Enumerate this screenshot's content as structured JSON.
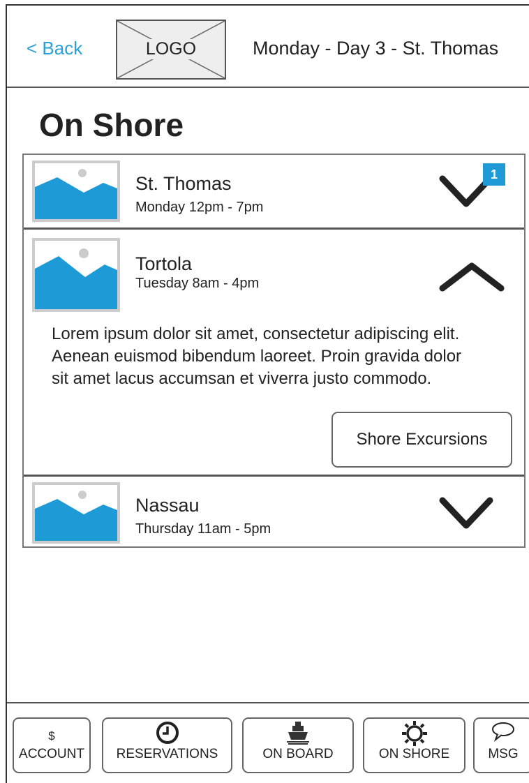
{
  "header": {
    "back_label": "< Back",
    "logo_label": "LOGO",
    "title": "Monday - Day 3 - St. Thomas"
  },
  "page": {
    "title": "On Shore"
  },
  "ports": [
    {
      "name": "St. Thomas",
      "time": "Monday 12pm - 7pm",
      "expanded": false,
      "badge": "1"
    },
    {
      "name": "Tortola",
      "time": "Tuesday 8am - 4pm",
      "expanded": true,
      "description": "Lorem ipsum dolor sit amet, consectetur adipiscing elit. Aenean euismod bibendum laoreet. Proin gravida dolor sit amet lacus accumsan et viverra justo commodo.",
      "button_label": "Shore Excursions"
    },
    {
      "name": "Nassau",
      "time": "Thursday 11am - 5pm",
      "expanded": false
    }
  ],
  "bottom_nav": {
    "account": {
      "icon_text": "$",
      "label": "ACCOUNT"
    },
    "reservations": {
      "icon": "clock-icon",
      "label": "RESERVATIONS"
    },
    "on_board": {
      "icon": "ship-icon",
      "label": "ON BOARD"
    },
    "on_shore": {
      "icon": "sun-icon",
      "label": "ON SHORE"
    },
    "msg": {
      "icon": "speech-bubble-icon",
      "label": "MSG"
    }
  },
  "colors": {
    "accent": "#2aa0d8",
    "image_placeholder": "#1e9bd7",
    "badge": "#1e9bd7"
  }
}
